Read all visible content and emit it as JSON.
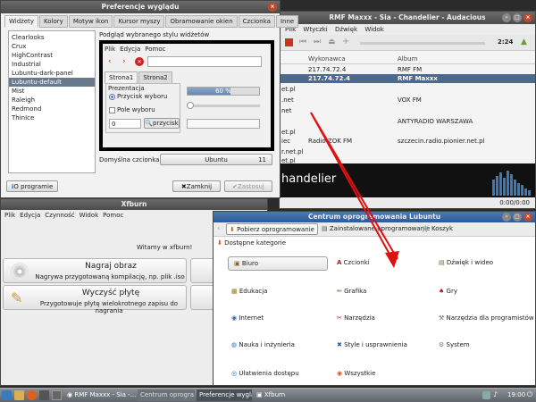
{
  "pref": {
    "title": "Preferencje wyglądu",
    "tabs": [
      "Widżety",
      "Kolory",
      "Motyw ikon",
      "Kursor myszy",
      "Obramowanie okien",
      "Czcionka",
      "Inne"
    ],
    "themes": [
      "Clearlooks",
      "Crux",
      "HighContrast",
      "Industrial",
      "Lubuntu-dark-panel",
      "Lubuntu-default",
      "Mist",
      "Raleigh",
      "Redmond",
      "ThinIce"
    ],
    "preview_label": "Podgląd wybranego stylu widżetów",
    "preview_menu": [
      "Plik",
      "Edycja",
      "Pomoc"
    ],
    "preview_tabs": [
      "Strona1",
      "Strona2"
    ],
    "prezentacja": "Prezentacja",
    "radio_label": "Przycisk wyboru",
    "check_label": "Pole wyboru",
    "progress_text": "60 %",
    "progress": 0.6,
    "spin_value": "0",
    "button_label": "przycisk",
    "font_label": "Domyślna czcionka:",
    "font_name": "Ubuntu",
    "font_size": "11",
    "about_label": "O programie",
    "close_label": "Zamknij",
    "apply_label": "Zastosuj"
  },
  "audacious": {
    "title": "RMF Maxxx - Sia - Chandelier - Audacious",
    "menu": [
      "Plik",
      "Wtyczki",
      "Dźwięk",
      "Widok"
    ],
    "time": "2:24",
    "col_artist": "Wykonawca",
    "col_album": "Album",
    "rows": [
      {
        "left": "",
        "artist": "217.74.72.4",
        "album": "RMF FM"
      },
      {
        "left": "",
        "artist": "217.74.72.4",
        "album": "RMF Maxxx"
      },
      {
        "left": "et.pl",
        "artist": "",
        "album": ""
      },
      {
        "left": ".net",
        "artist": "",
        "album": "VOX FM"
      },
      {
        "left": "net",
        "artist": "",
        "album": ""
      },
      {
        "left": "",
        "artist": "",
        "album": "ANTYRADIO WARSZAWA"
      },
      {
        "left": "et.pl",
        "artist": "",
        "album": ""
      },
      {
        "left": "iec",
        "artist": "Radio ZOK FM",
        "album": "szczecin.radio.pionier.net.pl"
      },
      {
        "left": "r.net.pl",
        "artist": "",
        "album": ""
      },
      {
        "left": "et.pl",
        "artist": "",
        "album": ""
      }
    ],
    "now_playing": "handelier",
    "status": "0:00/0:00"
  },
  "xfburn": {
    "title": "Xfburn",
    "menu": [
      "Plik",
      "Edycja",
      "Czynność",
      "Widok",
      "Pomoc"
    ],
    "welcome": "Witamy w xfburn!",
    "action1_title": "Nagraj obraz",
    "action1_desc": "Nagrywa przygotowaną kompilację, np. plik .iso",
    "action2_title": "Wyczyść płytę",
    "action2_desc": "Przygotowuje płytę wielokrotnego zapisu do nagrania"
  },
  "lubuntu": {
    "title": "Centrum oprogramowania Lubuntu",
    "toolbar": [
      "Pobierz oprogramowanie",
      "Zainstalowane oprogramowanie",
      "Koszyk"
    ],
    "section": "Dostępne kategorie",
    "categories": [
      [
        "Biuro",
        "Czcionki",
        "Dźwięk i wideo"
      ],
      [
        "Edukacja",
        "Grafika",
        "Gry"
      ],
      [
        "Internet",
        "Narzędzia",
        "Narzędzia dla programistów"
      ],
      [
        "Nauka i inżynieria",
        "Style i usprawnienia",
        "System"
      ],
      [
        "Ułatwienia dostępu",
        "Wszystkie",
        ""
      ]
    ]
  },
  "taskbar": {
    "tasks": [
      "RMF Maxxx - Sia -...",
      "Centrum oprogra...",
      "Preferencje wyglą...",
      "Xfburn"
    ],
    "clock": "19:00"
  },
  "colors": {
    "arrow": "#e01010",
    "selection": "#6a7a8e"
  }
}
